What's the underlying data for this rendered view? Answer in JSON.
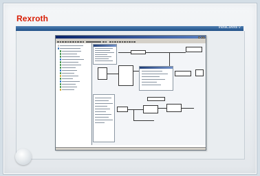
{
  "brand": {
    "name": "Rexroth",
    "color": "#d81e05"
  },
  "product": {
    "name": "IndraControl V"
  },
  "app": {
    "title": "",
    "menu_items": [
      "",
      "",
      "",
      "",
      "",
      "",
      "",
      ""
    ],
    "status": ""
  },
  "colors": {
    "accent_bar": "#1f4f86",
    "bezel": "#eceff2"
  },
  "icons": [
    "window-minimize-icon",
    "window-maximize-icon",
    "window-close-icon",
    "tree-node-icon",
    "power-button-icon"
  ]
}
